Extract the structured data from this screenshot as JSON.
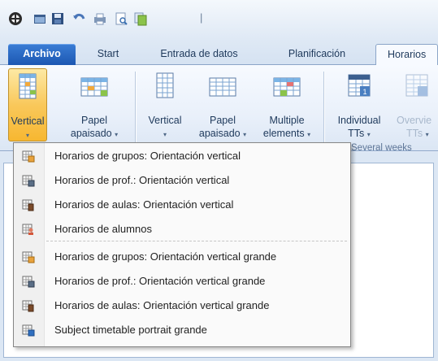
{
  "app": {
    "accent": "#1c57b2",
    "pressed_color": "#f9c85b"
  },
  "quick_access": {
    "icons": [
      "app-orb-icon",
      "folder-open-icon",
      "save-icon",
      "undo-icon",
      "print-icon",
      "print-preview-icon",
      "copy-icon",
      "customize-qat-icon"
    ],
    "separator": "|"
  },
  "tabs": [
    {
      "label": "Archivo"
    },
    {
      "label": "Start"
    },
    {
      "label": "Entrada de datos"
    },
    {
      "label": "Planificación"
    },
    {
      "label": "Horarios"
    }
  ],
  "ribbon": {
    "buttons": [
      {
        "line1": "Vertical",
        "line2": "▾",
        "icon": "grid-vertical-icon",
        "pressed": true
      },
      {
        "line1": "Papel",
        "line2": "apaisado",
        "icon": "grid-landscape-icon"
      },
      {
        "line1": "Vertical",
        "line2": "▾",
        "icon": "grid-vertical-icon"
      },
      {
        "line1": "Papel",
        "line2": "apaisado",
        "icon": "grid-landscape-icon"
      },
      {
        "line1": "Multiple",
        "line2": "elements",
        "icon": "multiple-elements-icon"
      },
      {
        "line1": "Individual",
        "line2": "TTs",
        "icon": "calendar-individual-icon"
      },
      {
        "line1": "Overvie",
        "line2": "TTs",
        "icon": "calendar-overview-icon"
      }
    ],
    "group_label": "Several weeks"
  },
  "menu": {
    "items": [
      {
        "label": "Horarios de grupos: Orientación vertical",
        "icon": "class-timetable-icon"
      },
      {
        "label": "Horarios de prof.: Orientación vertical",
        "icon": "teacher-timetable-icon"
      },
      {
        "label": "Horarios de aulas: Orientación vertical",
        "icon": "room-timetable-icon"
      },
      {
        "label": "Horarios de alumnos",
        "icon": "student-timetable-icon"
      },
      {
        "label": "Horarios de grupos: Orientación vertical grande",
        "icon": "class-timetable-icon"
      },
      {
        "label": "Horarios de prof.: Orientación vertical grande",
        "icon": "teacher-timetable-icon"
      },
      {
        "label": "Horarios de aulas: Orientación vertical grande",
        "icon": "room-timetable-icon"
      },
      {
        "label": "Subject timetable portrait grande",
        "icon": "subject-timetable-icon"
      }
    ]
  }
}
